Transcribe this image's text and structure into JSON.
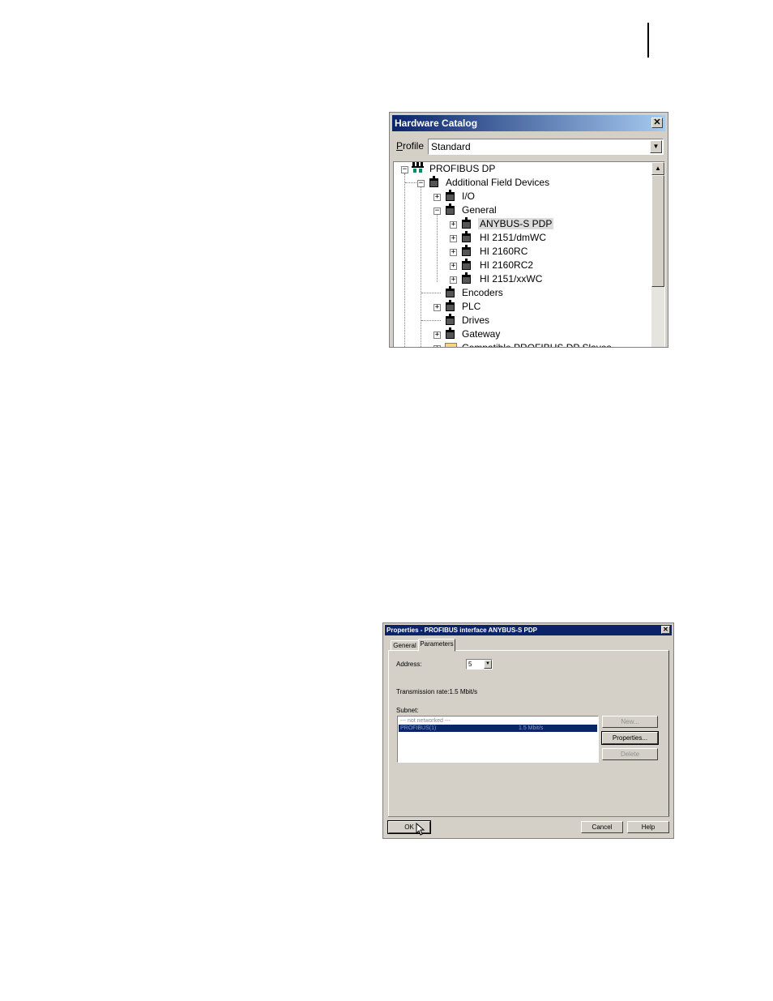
{
  "hardware_catalog": {
    "title": "Hardware Catalog",
    "close_glyph": "✕",
    "profile_label_prefix": "P",
    "profile_label_rest": "rofile",
    "profile_value": "Standard",
    "tree": {
      "root": "PROFIBUS DP",
      "additional_field_devices": "Additional Field Devices",
      "io": "I/O",
      "general": "General",
      "general_children": [
        "ANYBUS-S PDP",
        "HI 2151/dmWC",
        "HI 2160RC",
        "HI 2160RC2",
        "HI 2151/xxWC"
      ],
      "encoders": "Encoders",
      "plc": "PLC",
      "drives": "Drives",
      "gateway": "Gateway",
      "compatible": "Compatible PROFIBUS DP Slaves"
    }
  },
  "properties_dialog": {
    "title": "Properties - PROFIBUS interface  ANYBUS-S PDP",
    "close_glyph": "✕",
    "tabs": [
      "General",
      "Parameters"
    ],
    "address_label": "Address:",
    "address_value": "5",
    "transmission_rate": "Transmission rate:1.5 Mbit/s",
    "subnet_label": "Subnet:",
    "subnet_rows": [
      {
        "name": "--- not networked ---",
        "rate": ""
      },
      {
        "name": "PROFIBUS(1)",
        "rate": "1.5 Mbit/s"
      }
    ],
    "buttons": {
      "new": "New...",
      "properties": "Properties...",
      "delete": "Delete",
      "ok": "OK",
      "cancel": "Cancel",
      "help": "Help"
    }
  }
}
